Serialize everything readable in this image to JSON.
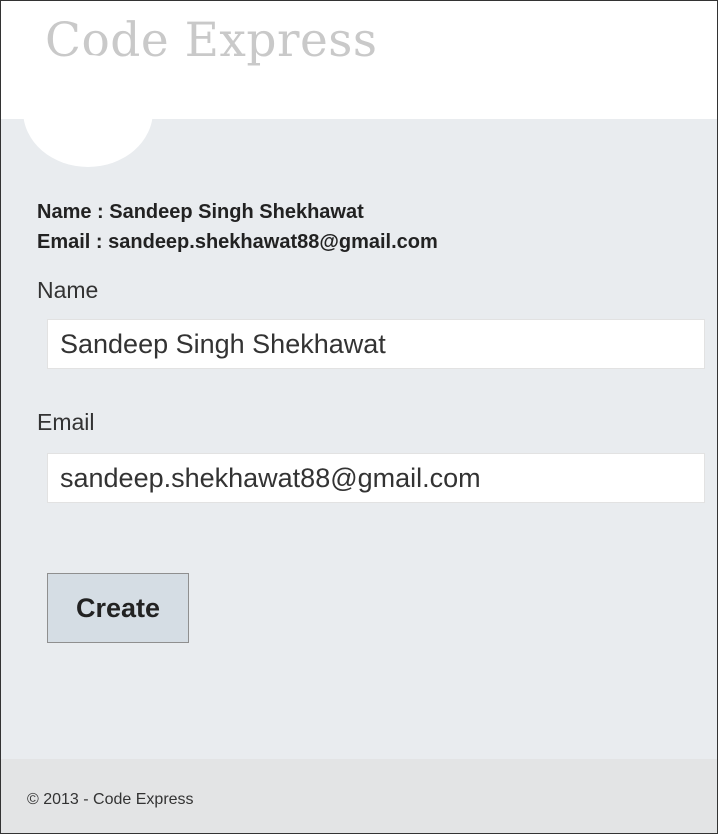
{
  "header": {
    "title": "Code Express"
  },
  "summary": {
    "name_line": "Name : Sandeep Singh Shekhawat",
    "email_line": "Email : sandeep.shekhawat88@gmail.com"
  },
  "form": {
    "name_label": "Name",
    "name_value": "Sandeep Singh Shekhawat",
    "email_label": "Email",
    "email_value": "sandeep.shekhawat88@gmail.com",
    "submit_label": "Create"
  },
  "footer": {
    "copyright": "© 2013 - Code Express"
  },
  "colors": {
    "title": "#c9c9c9",
    "main_background": "#e9ecef",
    "button_background": "#d5dde4",
    "footer_background": "#e3e4e5"
  }
}
